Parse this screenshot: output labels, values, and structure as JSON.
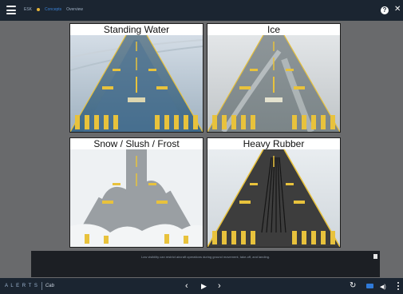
{
  "topbar": {
    "breadcrumb": [
      "ESK",
      "Concepts",
      "Overview"
    ]
  },
  "slide": {
    "panels": [
      {
        "title": "Standing Water"
      },
      {
        "title": "Ice"
      },
      {
        "title": "Snow / Slush / Frost"
      },
      {
        "title": "Heavy Rubber"
      }
    ],
    "caption": "Low visibility can restrict aircraft operations during ground movement, take-off, and landing."
  },
  "player": {
    "logo_text": "A L E R T S",
    "logo_mark": "Cab",
    "prev_icon": "‹",
    "play_icon": "▶",
    "next_icon": "›",
    "replay_icon": "↻",
    "volume_icon": "◀)"
  },
  "colors": {
    "bar": "#1b2531",
    "stage": "#696a6c",
    "accent": "#2f7ad9",
    "runway_marking_yellow": "#e8c23c"
  },
  "icons": [
    "menu-icon",
    "help-icon",
    "close-icon",
    "notes-icon",
    "prev-icon",
    "play-icon",
    "next-icon",
    "replay-icon",
    "captions-icon",
    "volume-icon",
    "more-icon"
  ]
}
